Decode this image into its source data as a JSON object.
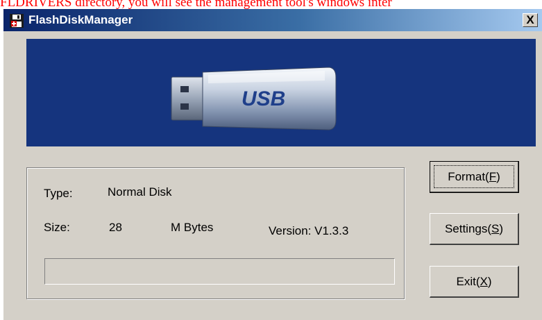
{
  "caption": "FLDRIVERS directory, you will see the management tool's windows inter",
  "window": {
    "title": "FlashDiskManager",
    "close_label": "X"
  },
  "banner": {
    "usb_text": "USB"
  },
  "info": {
    "type_label": "Type:",
    "type_value": "Normal Disk",
    "size_label": "Size:",
    "size_value": "28",
    "size_unit": "M Bytes",
    "version_text": "Version: V1.3.3",
    "progress_fraction": 0
  },
  "buttons": {
    "format": {
      "text": "Format(",
      "key": "F",
      "close": ")"
    },
    "settings": {
      "text": "Settings(",
      "key": "S",
      "close": ")"
    },
    "exit": {
      "text": "Exit(",
      "key": "X",
      "close": ")"
    }
  },
  "colors": {
    "banner_bg": "#15347e",
    "dialog_bg": "#d4d0c8",
    "caption_text": "#ff0000"
  },
  "icons": {
    "app": "floppy-disk-icon",
    "close": "close-icon",
    "usb": "usb-drive-icon"
  }
}
